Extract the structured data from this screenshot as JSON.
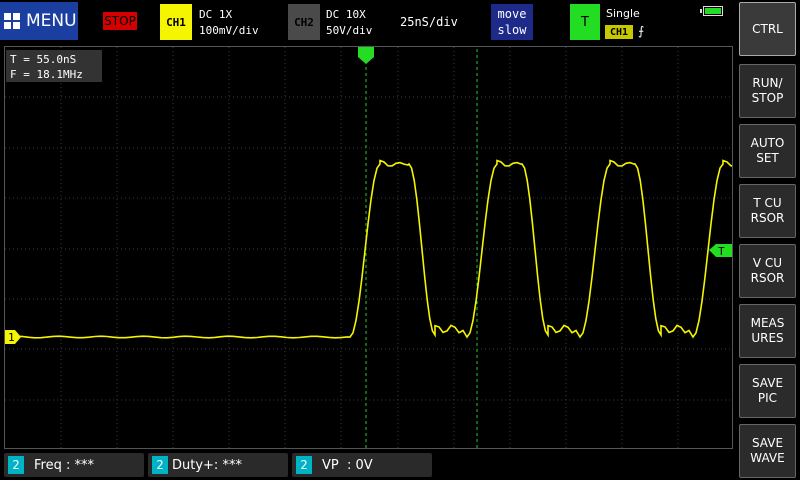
{
  "header": {
    "menu_label": "MENU",
    "run_state": "STOP",
    "ch1": {
      "label": "CH1",
      "coupling": "DC  1X",
      "scale": "100mV/div"
    },
    "ch2": {
      "label": "CH2",
      "coupling": "DC  10X",
      "scale": "50V/div"
    },
    "timebase": "25nS/div",
    "move_line1": "move",
    "move_line2": "slow",
    "trigger": {
      "label": "T",
      "mode": "Single",
      "channel": "CH1",
      "edge": "⨍"
    },
    "battery_level": 1.0
  },
  "readout": {
    "period": "T = 55.0nS",
    "frequency": "F = 18.1MHz"
  },
  "markers": {
    "channel_marker": "1",
    "trigger_level_marker": "T"
  },
  "sidebar": {
    "buttons": [
      {
        "id": "ctrl",
        "label": "CTRL"
      },
      {
        "id": "run-stop",
        "label": "RUN/\nSTOP"
      },
      {
        "id": "auto-set",
        "label": "AUTO\nSET"
      },
      {
        "id": "t-cursor",
        "label": "T CU\nRSOR"
      },
      {
        "id": "v-cursor",
        "label": "V CU\nRSOR"
      },
      {
        "id": "measures",
        "label": "MEAS\nURES"
      },
      {
        "id": "save-pic",
        "label": "SAVE\nPIC"
      },
      {
        "id": "save-wave",
        "label": "SAVE\nWAVE"
      }
    ]
  },
  "measurements": [
    {
      "channel": "2",
      "text": "Freq : ***"
    },
    {
      "channel": "2",
      "text": "Duty+: ***"
    },
    {
      "channel": "2",
      "text": "VP  : 0V"
    }
  ],
  "colors": {
    "ch1": "#f5f500",
    "ch2": "#4a4a4a",
    "trigger": "#22dd22",
    "cursor": "#22cc22",
    "menu": "#1a3fa0",
    "stop": "#d40000",
    "measure_badge": "#00b4c8"
  }
}
